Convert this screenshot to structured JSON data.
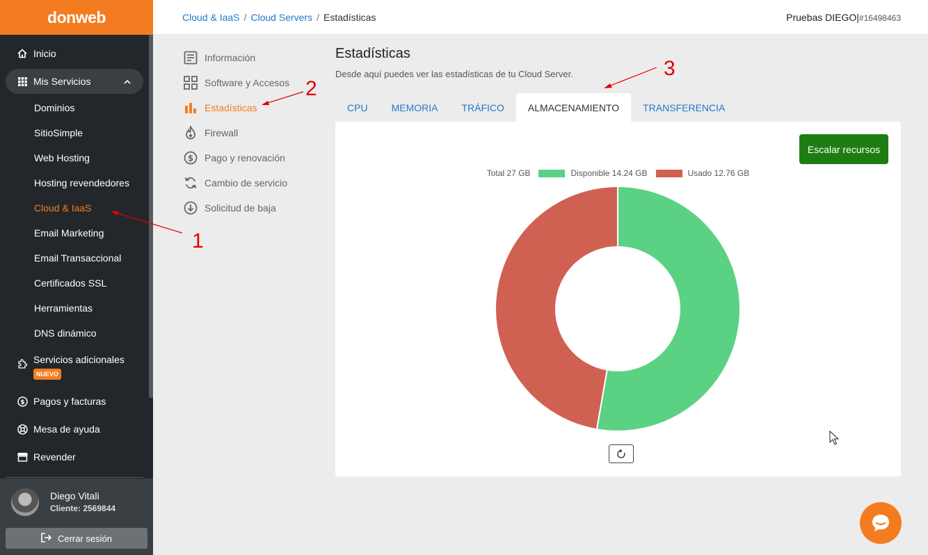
{
  "brand": {
    "logo": "donweb"
  },
  "sidebar": {
    "inicio": "Inicio",
    "mis_servicios": "Mis Servicios",
    "sub_items": [
      "Dominios",
      "SitioSimple",
      "Web Hosting",
      "Hosting revendedores",
      "Cloud & IaaS",
      "Email Marketing",
      "Email Transaccional",
      "Certificados SSL",
      "Herramientas",
      "DNS dinámico"
    ],
    "servicios_adicionales": "Servicios adicionales",
    "badge_nuevo": "NUEVO",
    "pagos": "Pagos y facturas",
    "mesa": "Mesa de ayuda",
    "revender": "Revender"
  },
  "profile": {
    "name": "Diego Vitali",
    "client": "Cliente: 2569844",
    "logout": "Cerrar sesión"
  },
  "breadcrumb": {
    "level1": "Cloud & IaaS",
    "level2": "Cloud Servers",
    "current": "Estadísticas",
    "sep": "/"
  },
  "account": {
    "name": "Pruebas DIEGO",
    "sep": "|",
    "id": "#16498463"
  },
  "submenu": [
    "Información",
    "Software y Accesos",
    "Estadísticas",
    "Firewall",
    "Pago y renovación",
    "Cambio de servicio",
    "Solicitud de baja"
  ],
  "page": {
    "title": "Estadísticas",
    "subtitle": "Desde aquí puedes ver las estadísticas de tu Cloud Server."
  },
  "tabs": [
    "CPU",
    "MEMORIA",
    "TRÁFICO",
    "ALMACENAMIENTO",
    "TRANSFERENCIA"
  ],
  "actions": {
    "scale": "Escalar recursos"
  },
  "annotations": [
    "1",
    "2",
    "3"
  ],
  "colors": {
    "brand": "#f47c20",
    "available": "#5bd183",
    "used": "#d06152",
    "link": "#2178c8",
    "scale_button": "#1e7d12"
  },
  "chart_data": {
    "type": "pie",
    "legend_total": "Total 27 GB",
    "labels": [
      "Disponible 14.24 GB",
      "Usado 12.76 GB"
    ],
    "categories": [
      "Disponible",
      "Usado"
    ],
    "values": [
      14.24,
      12.76
    ],
    "unit": "GB",
    "total": 27,
    "legend_position": "top"
  }
}
